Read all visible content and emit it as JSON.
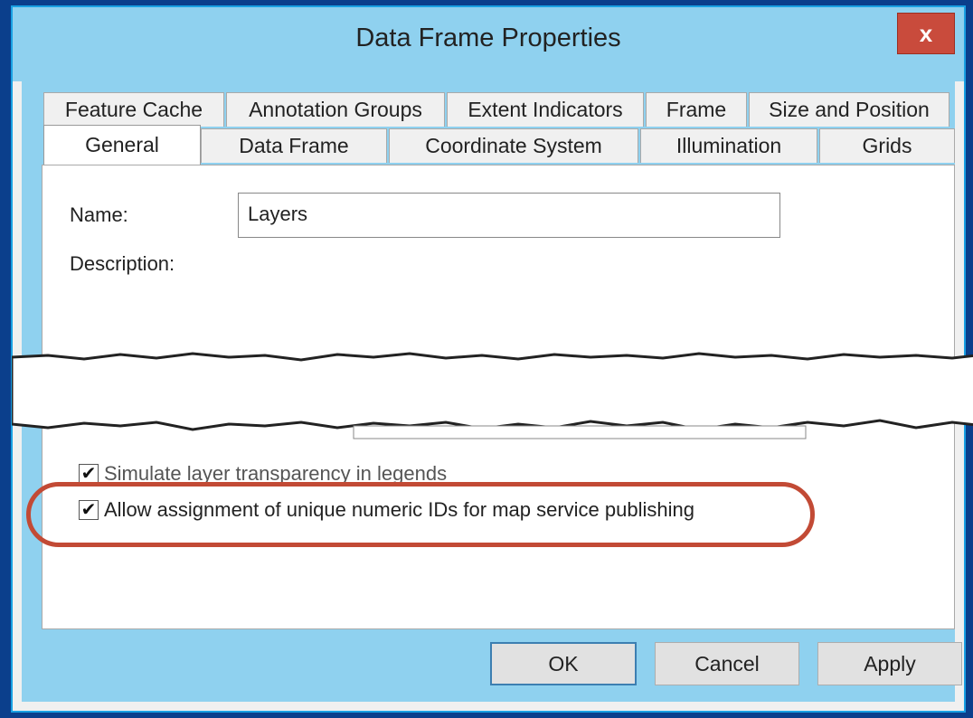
{
  "window": {
    "title": "Data Frame Properties",
    "close_label": "x"
  },
  "tabs": {
    "back_row": [
      "Feature Cache",
      "Annotation Groups",
      "Extent Indicators",
      "Frame",
      "Size and Position"
    ],
    "front_row": [
      "General",
      "Data Frame",
      "Coordinate System",
      "Illumination",
      "Grids"
    ],
    "selected": "General"
  },
  "general": {
    "name_label": "Name:",
    "name_value": "Layers",
    "description_label": "Description:",
    "simulate_label": "Simulate layer transparency in legends",
    "simulate_checked": true,
    "unique_ids_label": "Allow assignment of unique numeric IDs for map service publishing",
    "unique_ids_checked": true
  },
  "buttons": {
    "ok": "OK",
    "cancel": "Cancel",
    "apply": "Apply"
  },
  "colors": {
    "highlight_oval": "#c24a35",
    "titlebar": "#8fd1ef",
    "close_button": "#c94b3c"
  }
}
